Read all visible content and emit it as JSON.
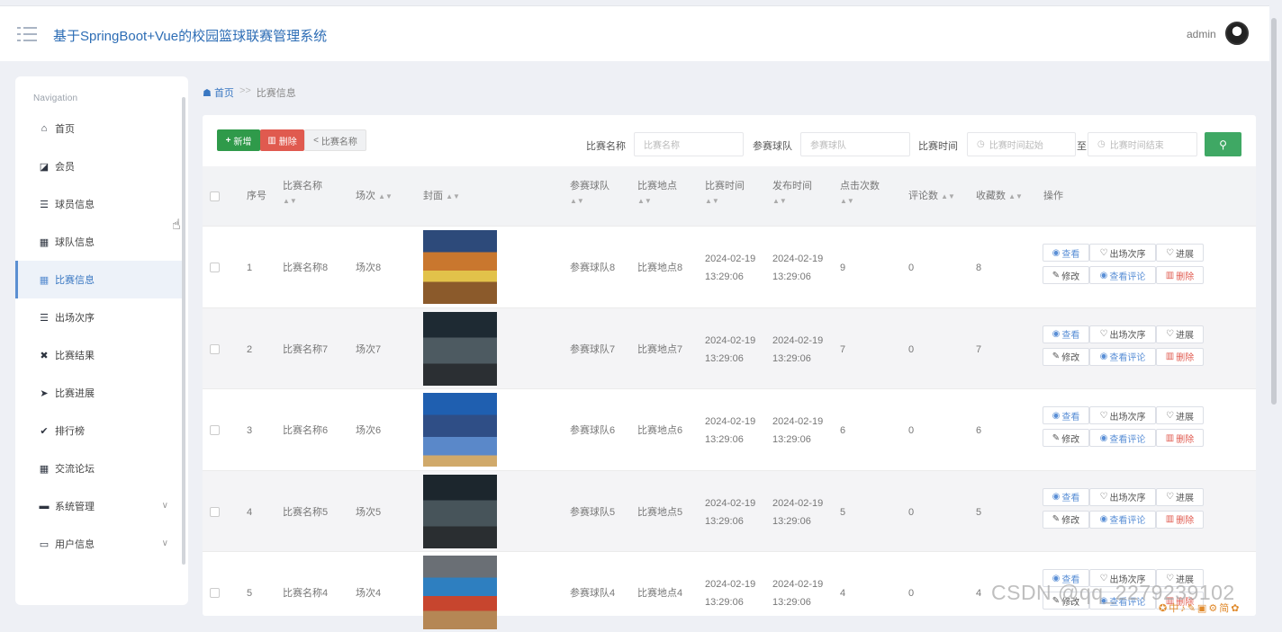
{
  "header": {
    "title": "基于SpringBoot+Vue的校园篮球联赛管理系统",
    "user": "admin"
  },
  "sidebar": {
    "title": "Navigation",
    "items": [
      {
        "label": "首页",
        "icon": "home-icon",
        "glyph": "⌂"
      },
      {
        "label": "会员",
        "icon": "chart-icon",
        "glyph": "◪"
      },
      {
        "label": "球员信息",
        "icon": "list-icon",
        "glyph": "☰"
      },
      {
        "label": "球队信息",
        "icon": "grid-icon",
        "glyph": "▦"
      },
      {
        "label": "比赛信息",
        "icon": "grid-icon",
        "glyph": "▦",
        "active": true
      },
      {
        "label": "出场次序",
        "icon": "list-icon",
        "glyph": "☰"
      },
      {
        "label": "比赛结果",
        "icon": "clipboard-x-icon",
        "glyph": "✖"
      },
      {
        "label": "比赛进展",
        "icon": "paper-plane-icon",
        "glyph": "➤"
      },
      {
        "label": "排行榜",
        "icon": "clipboard-check-icon",
        "glyph": "✔"
      },
      {
        "label": "交流论坛",
        "icon": "grid-icon",
        "glyph": "▦"
      },
      {
        "label": "系统管理",
        "icon": "comment-icon",
        "glyph": "▬",
        "dropdown": true
      },
      {
        "label": "用户信息",
        "icon": "card-icon",
        "glyph": "▭",
        "dropdown": true
      }
    ]
  },
  "breadcrumb": {
    "home": "首页",
    "separator": ">>",
    "current": "比赛信息"
  },
  "toolbar": {
    "add": "新增",
    "delete": "删除",
    "name_btn": "比赛名称"
  },
  "filters": {
    "name_label": "比赛名称",
    "name_placeholder": "比赛名称",
    "team_label": "参赛球队",
    "team_placeholder": "参赛球队",
    "time_label": "比赛时间",
    "time_start": "比赛时间起始",
    "to": "至",
    "time_end": "比赛时间结束"
  },
  "columns": [
    "序号",
    "比赛名称",
    "场次",
    "封面",
    "参赛球队",
    "比赛地点",
    "比赛时间",
    "发布时间",
    "点击次数",
    "评论数",
    "收藏数",
    "操作"
  ],
  "actions": {
    "view": "查看",
    "order": "出场次序",
    "progress": "进展",
    "edit": "修改",
    "comments": "查看评论",
    "delete": "删除"
  },
  "rows": [
    {
      "no": "1",
      "name": "比赛名称8",
      "session": "场次8",
      "team": "参赛球队8",
      "place": "比赛地点8",
      "time": "2024-02-19 13:29:06",
      "pub": "2024-02-19 13:29:06",
      "clicks": "9",
      "comments": "0",
      "favs": "8"
    },
    {
      "no": "2",
      "name": "比赛名称7",
      "session": "场次7",
      "team": "参赛球队7",
      "place": "比赛地点7",
      "time": "2024-02-19 13:29:06",
      "pub": "2024-02-19 13:29:06",
      "clicks": "7",
      "comments": "0",
      "favs": "7"
    },
    {
      "no": "3",
      "name": "比赛名称6",
      "session": "场次6",
      "team": "参赛球队6",
      "place": "比赛地点6",
      "time": "2024-02-19 13:29:06",
      "pub": "2024-02-19 13:29:06",
      "clicks": "6",
      "comments": "0",
      "favs": "6"
    },
    {
      "no": "4",
      "name": "比赛名称5",
      "session": "场次5",
      "team": "参赛球队5",
      "place": "比赛地点5",
      "time": "2024-02-19 13:29:06",
      "pub": "2024-02-19 13:29:06",
      "clicks": "5",
      "comments": "0",
      "favs": "5"
    },
    {
      "no": "5",
      "name": "比赛名称4",
      "session": "场次4",
      "team": "参赛球队4",
      "place": "比赛地点4",
      "time": "2024-02-19 13:29:06",
      "pub": "2024-02-19 13:29:06",
      "clicks": "4",
      "comments": "0",
      "favs": "4"
    }
  ],
  "watermark": "CSDN @qq_2279239102"
}
